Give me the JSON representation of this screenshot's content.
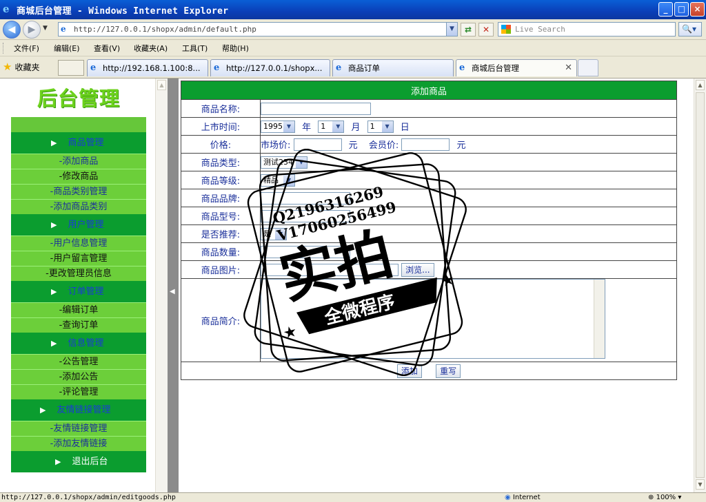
{
  "window": {
    "title": "商城后台管理 - Windows Internet Explorer",
    "minimize": "_",
    "maximize": "□",
    "close": "×"
  },
  "address": {
    "url": "http://127.0.0.1/shopx/admin/default.php",
    "search_placeholder": "Live Search"
  },
  "menu": [
    "文件(F)",
    "编辑(E)",
    "查看(V)",
    "收藏夹(A)",
    "工具(T)",
    "帮助(H)"
  ],
  "favorites_label": "收藏夹",
  "tabs": [
    {
      "label": "http://192.168.1.100:8..."
    },
    {
      "label": "http://127.0.0.1/shopx..."
    },
    {
      "label": "商品订单"
    },
    {
      "label": "商城后台管理"
    }
  ],
  "sidebar": {
    "logo": "后台管理",
    "sections": [
      {
        "title": "商品管理",
        "items": [
          "-添加商品",
          "-修改商品",
          "-商品类别管理",
          "-添加商品类别"
        ]
      },
      {
        "title": "用户管理",
        "items": [
          "-用户信息管理",
          "-用户留言管理",
          "-更改管理员信息"
        ]
      },
      {
        "title": "订单管理",
        "items": [
          "-编辑订单",
          "-查询订单"
        ]
      },
      {
        "title": "信息管理",
        "items": [
          "-公告管理",
          "-添加公告",
          "-评论管理"
        ]
      },
      {
        "title": "友情链接管理",
        "items": [
          "-友情链接管理",
          "-添加友情链接"
        ]
      },
      {
        "title": "退出后台",
        "items": []
      }
    ]
  },
  "form": {
    "header": "添加商品",
    "name_label": "商品名称:",
    "date_label": "上市时间:",
    "year_value": "1995",
    "year_unit": "年",
    "month_value": "1",
    "month_unit": "月",
    "day_value": "1",
    "day_unit": "日",
    "price_label": "价格:",
    "market_price_label": "市场价:",
    "market_price_unit": "元",
    "member_price_label": "会员价:",
    "member_price_unit": "元",
    "type_label": "商品类型:",
    "type_value": "测试234",
    "grade_label": "商品等级:",
    "grade_value": "精品",
    "brand_label": "商品品牌:",
    "model_label": "商品型号:",
    "recommend_label": "是否推荐:",
    "recommend_value": "是",
    "quantity_label": "商品数量:",
    "image_label": "商品图片:",
    "browse_button": "浏览...",
    "intro_label": "商品简介:",
    "submit_button": "添加",
    "reset_button": "重写"
  },
  "watermark": {
    "line1": "Q2196316269",
    "line2": "V17060256499",
    "main": "实拍",
    "banner": "全微程序"
  },
  "status": {
    "url": "http://127.0.0.1/shopx/admin/editgoods.php",
    "zone": "Internet",
    "zoom": "100%"
  }
}
